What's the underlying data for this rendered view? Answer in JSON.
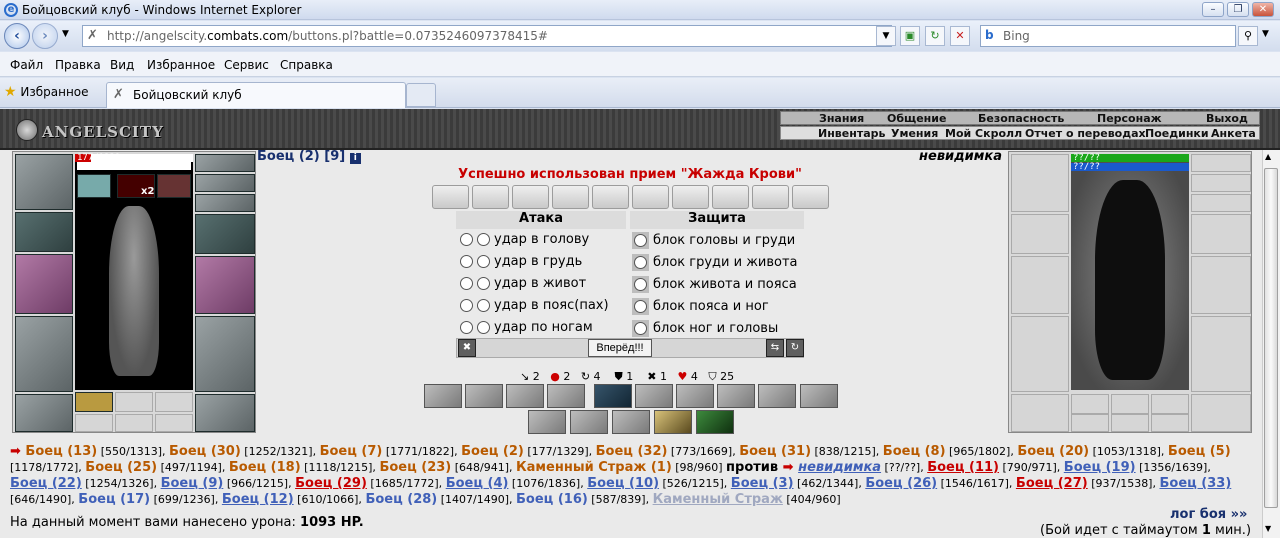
{
  "window": {
    "title": "Бойцовский клуб - Windows Internet Explorer",
    "min": "–",
    "max": "❐",
    "close": "✕"
  },
  "address": {
    "url_pre": "http://angelscity.",
    "url_host": "combats.com",
    "url_post": "/buttons.pl?battle=0.0735246097378415#",
    "search_placeholder": "Bing"
  },
  "menu": [
    "Файл",
    "Правка",
    "Вид",
    "Избранное",
    "Сервис",
    "Справка"
  ],
  "tabs": {
    "favorites": "Избранное",
    "active": "Бойцовский клуб"
  },
  "game": {
    "logo": "ANGELSCITY",
    "topnav": [
      "Знания",
      "Общение",
      "Безопасность",
      "Персонаж",
      "Выход"
    ],
    "subnav": [
      "Инвентарь",
      "Умения",
      "Мой Скролл",
      "Отчет о переводах",
      "Поединки",
      "Анкета"
    ]
  },
  "player": {
    "hp": "177/1329",
    "hp_fraction": 0.133,
    "buff_count": "x2",
    "name": "Боец (2)",
    "level": "[9]"
  },
  "opponent": {
    "name": "невидимка",
    "hp": "??/??",
    "mana": "??/??"
  },
  "message": "Успешно использован прием \"Жажда Крови\"",
  "attack": {
    "header": "Атака",
    "rows": [
      "удар в голову",
      "удар в грудь",
      "удар в живот",
      "удар в пояс(пах)",
      "удар по ногам"
    ]
  },
  "defense": {
    "header": "Защита",
    "rows": [
      "блок головы и груди",
      "блок груди и живота",
      "блок живота и пояса",
      "блок пояса и ног",
      "блок ног и головы"
    ]
  },
  "go_button": "Вперёд!!!",
  "stats": [
    {
      "icon": "↘",
      "val": "2"
    },
    {
      "icon": "●",
      "val": "2"
    },
    {
      "icon": "↻",
      "val": "4"
    },
    {
      "icon": "⛊",
      "val": "1"
    },
    {
      "icon": "✖",
      "val": "1"
    },
    {
      "icon": "♥",
      "val": "4"
    },
    {
      "icon": "⛉",
      "val": "25"
    }
  ],
  "log": [
    {
      "t": "➡ ",
      "c": "arrow"
    },
    {
      "t": "Боец (13)",
      "c": "o"
    },
    {
      "t": " [550/1313], ",
      "c": "hp"
    },
    {
      "t": "Боец (30)",
      "c": "o"
    },
    {
      "t": " [1252/1321], ",
      "c": "hp"
    },
    {
      "t": "Боец (7)",
      "c": "o"
    },
    {
      "t": " [1771/1822], ",
      "c": "hp"
    },
    {
      "t": "Боец (2)",
      "c": "o"
    },
    {
      "t": " [177/1329], ",
      "c": "hp"
    },
    {
      "t": "Боец (32)",
      "c": "o"
    },
    {
      "t": " [773/1669], ",
      "c": "hp"
    },
    {
      "t": "Боец (31)",
      "c": "o"
    },
    {
      "t": " [838/1215], ",
      "c": "hp"
    },
    {
      "t": "Боец (8)",
      "c": "o"
    },
    {
      "t": " [965/1802], ",
      "c": "hp"
    },
    {
      "t": "Боец (20)",
      "c": "o"
    },
    {
      "t": " [1053/1318], ",
      "c": "hp"
    },
    {
      "t": "Боец (5)",
      "c": "o"
    },
    {
      "t": " [1178/1772], ",
      "c": "hp"
    },
    {
      "t": "Боец (25)",
      "c": "o"
    },
    {
      "t": " [497/1194], ",
      "c": "hp"
    },
    {
      "t": "Боец (18)",
      "c": "o"
    },
    {
      "t": " [1118/1215], ",
      "c": "hp"
    },
    {
      "t": "Боец (23)",
      "c": "o"
    },
    {
      "t": " [648/941], ",
      "c": "hp"
    },
    {
      "t": "Каменный Страж (1)",
      "c": "o"
    },
    {
      "t": " [98/960] ",
      "c": "hp"
    },
    {
      "t": " против ",
      "c": "vs"
    },
    {
      "t": " ➡ ",
      "c": "arrow"
    },
    {
      "t": "невидимка",
      "c": "bi"
    },
    {
      "t": " [??/??], ",
      "c": "hp"
    },
    {
      "t": "Боец (11)",
      "c": "r"
    },
    {
      "t": " [790/971], ",
      "c": "hp"
    },
    {
      "t": "Боец (19)",
      "c": "b"
    },
    {
      "t": " [1356/1639], ",
      "c": "hp"
    },
    {
      "t": "Боец (22)",
      "c": "b"
    },
    {
      "t": " [1254/1326], ",
      "c": "hp"
    },
    {
      "t": "Боец (9)",
      "c": "b"
    },
    {
      "t": " [966/1215], ",
      "c": "hp"
    },
    {
      "t": "Боец (29)",
      "c": "r"
    },
    {
      "t": " [1685/1772], ",
      "c": "hp"
    },
    {
      "t": "Боец (4)",
      "c": "b"
    },
    {
      "t": " [1076/1836], ",
      "c": "hp"
    },
    {
      "t": "Боец (10)",
      "c": "b"
    },
    {
      "t": " [526/1215], ",
      "c": "hp"
    },
    {
      "t": "Боец (3)",
      "c": "b"
    },
    {
      "t": " [462/1344], ",
      "c": "hp"
    },
    {
      "t": "Боец (26)",
      "c": "b"
    },
    {
      "t": " [1546/1617], ",
      "c": "hp"
    },
    {
      "t": "Боец (27)",
      "c": "r"
    },
    {
      "t": " [937/1538], ",
      "c": "hp"
    },
    {
      "t": "Боец (33)",
      "c": "b"
    },
    {
      "t": " [646/1490], ",
      "c": "hp"
    },
    {
      "t": "Боец (17)",
      "c": "bn"
    },
    {
      "t": " [699/1236], ",
      "c": "hp"
    },
    {
      "t": "Боец (12)",
      "c": "b"
    },
    {
      "t": " [610/1066], ",
      "c": "hp"
    },
    {
      "t": "Боец (28)",
      "c": "bn"
    },
    {
      "t": " [1407/1490], ",
      "c": "hp"
    },
    {
      "t": "Боец (16)",
      "c": "bn"
    },
    {
      "t": " [587/839], ",
      "c": "hp"
    },
    {
      "t": "Каменный Страж",
      "c": "gry"
    },
    {
      "t": " [404/960]",
      "c": "hp"
    }
  ],
  "damage": {
    "label": "На данный момент вами нанесено урона:",
    "value": "1093 HP."
  },
  "log_link": "лог боя »»",
  "timeout": {
    "pre": "(Бой идет с таймаутом ",
    "num": "1",
    "post": " мин.)"
  }
}
